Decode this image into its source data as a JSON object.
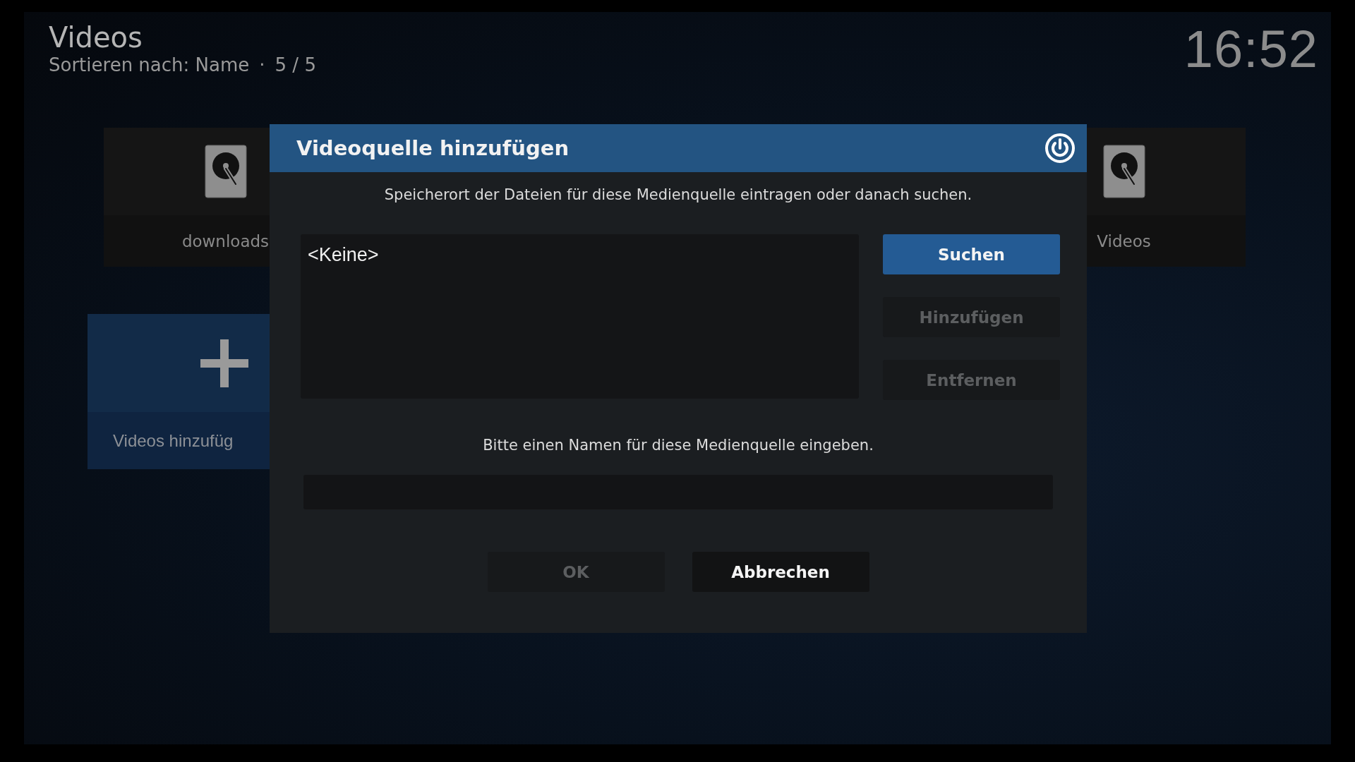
{
  "header": {
    "title": "Videos",
    "sort_label": "Sortieren nach: Name",
    "separator": "·",
    "count": "5 / 5",
    "clock": "16:52"
  },
  "sources": [
    {
      "kind": "drive",
      "label": "downloads",
      "selected": false
    },
    {
      "kind": "drive",
      "label": "Videos",
      "selected": false
    }
  ],
  "add_tile": {
    "label": "Videos hinzufüg",
    "selected": true
  },
  "dialog": {
    "title": "Videoquelle hinzufügen",
    "description": "Speicherort der Dateien für diese Medienquelle eintragen oder danach suchen.",
    "paths": [
      "<Keine>"
    ],
    "path_buttons": [
      {
        "label": "Suchen",
        "focused": true,
        "disabled": false
      },
      {
        "label": "Hinzufügen",
        "focused": false,
        "disabled": true
      },
      {
        "label": "Entfernen",
        "focused": false,
        "disabled": true
      }
    ],
    "name_prompt": "Bitte einen Namen für diese Medienquelle eingeben.",
    "buttons": [
      {
        "label": "OK",
        "focused": false,
        "disabled": true
      },
      {
        "label": "Abbrechen",
        "focused": false,
        "disabled": false
      }
    ]
  }
}
